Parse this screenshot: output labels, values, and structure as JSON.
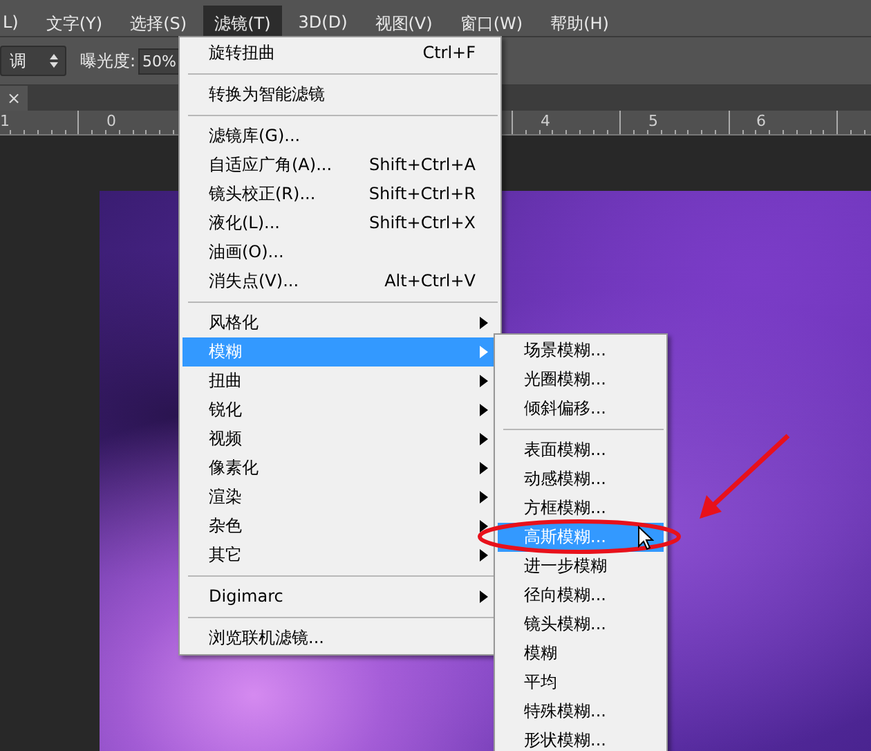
{
  "menu_bar": {
    "items": [
      {
        "label": "L)",
        "selected": false
      },
      {
        "label": "文字(Y)",
        "selected": false
      },
      {
        "label": "选择(S)",
        "selected": false
      },
      {
        "label": "滤镜(T)",
        "selected": true
      },
      {
        "label": "3D(D)",
        "selected": false
      },
      {
        "label": "视图(V)",
        "selected": false
      },
      {
        "label": "窗口(W)",
        "selected": false
      },
      {
        "label": "帮助(H)",
        "selected": false
      }
    ]
  },
  "options_bar": {
    "mode_value": "调",
    "exposure_label": "曝光度:",
    "exposure_value": "50%"
  },
  "document_tab": {
    "close": "×"
  },
  "ruler": {
    "labels": [
      "1",
      "0",
      "4",
      "5",
      "6"
    ]
  },
  "filter_menu": {
    "items": [
      {
        "kind": "item",
        "label": "旋转扭曲",
        "shortcut": "Ctrl+F",
        "submenu": false,
        "selected": false
      },
      {
        "kind": "separator"
      },
      {
        "kind": "item",
        "label": "转换为智能滤镜",
        "submenu": false,
        "selected": false
      },
      {
        "kind": "separator"
      },
      {
        "kind": "item",
        "label": "滤镜库(G)...",
        "submenu": false,
        "selected": false
      },
      {
        "kind": "item",
        "label": "自适应广角(A)...",
        "shortcut": "Shift+Ctrl+A",
        "submenu": false,
        "selected": false
      },
      {
        "kind": "item",
        "label": "镜头校正(R)...",
        "shortcut": "Shift+Ctrl+R",
        "submenu": false,
        "selected": false
      },
      {
        "kind": "item",
        "label": "液化(L)...",
        "shortcut": "Shift+Ctrl+X",
        "submenu": false,
        "selected": false
      },
      {
        "kind": "item",
        "label": "油画(O)...",
        "submenu": false,
        "selected": false
      },
      {
        "kind": "item",
        "label": "消失点(V)...",
        "shortcut": "Alt+Ctrl+V",
        "submenu": false,
        "selected": false
      },
      {
        "kind": "separator"
      },
      {
        "kind": "item",
        "label": "风格化",
        "submenu": true,
        "selected": false
      },
      {
        "kind": "item",
        "label": "模糊",
        "submenu": true,
        "selected": true
      },
      {
        "kind": "item",
        "label": "扭曲",
        "submenu": true,
        "selected": false
      },
      {
        "kind": "item",
        "label": "锐化",
        "submenu": true,
        "selected": false
      },
      {
        "kind": "item",
        "label": "视频",
        "submenu": true,
        "selected": false
      },
      {
        "kind": "item",
        "label": "像素化",
        "submenu": true,
        "selected": false
      },
      {
        "kind": "item",
        "label": "渲染",
        "submenu": true,
        "selected": false
      },
      {
        "kind": "item",
        "label": "杂色",
        "submenu": true,
        "selected": false
      },
      {
        "kind": "item",
        "label": "其它",
        "submenu": true,
        "selected": false
      },
      {
        "kind": "separator"
      },
      {
        "kind": "item",
        "label": "Digimarc",
        "submenu": true,
        "selected": false
      },
      {
        "kind": "separator"
      },
      {
        "kind": "item",
        "label": "浏览联机滤镜...",
        "submenu": false,
        "selected": false
      }
    ]
  },
  "blur_submenu": {
    "items": [
      {
        "kind": "item",
        "label": "场景模糊...",
        "selected": false
      },
      {
        "kind": "item",
        "label": "光圈模糊...",
        "selected": false
      },
      {
        "kind": "item",
        "label": "倾斜偏移...",
        "selected": false
      },
      {
        "kind": "separator"
      },
      {
        "kind": "item",
        "label": "表面模糊...",
        "selected": false
      },
      {
        "kind": "item",
        "label": "动感模糊...",
        "selected": false
      },
      {
        "kind": "item",
        "label": "方框模糊...",
        "selected": false
      },
      {
        "kind": "item",
        "label": "高斯模糊...",
        "selected": true
      },
      {
        "kind": "item",
        "label": "进一步模糊",
        "selected": false
      },
      {
        "kind": "item",
        "label": "径向模糊...",
        "selected": false
      },
      {
        "kind": "item",
        "label": "镜头模糊...",
        "selected": false
      },
      {
        "kind": "item",
        "label": "模糊",
        "selected": false
      },
      {
        "kind": "item",
        "label": "平均",
        "selected": false
      },
      {
        "kind": "item",
        "label": "特殊模糊...",
        "selected": false
      },
      {
        "kind": "item",
        "label": "形状模糊...",
        "selected": false
      }
    ]
  }
}
